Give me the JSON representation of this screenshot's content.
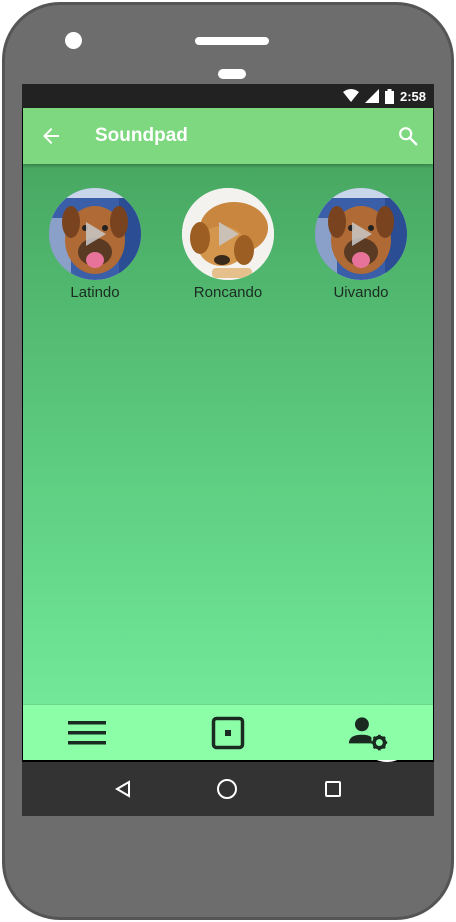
{
  "status": {
    "time": "2:58"
  },
  "appbar": {
    "title": "Soundpad"
  },
  "pads": [
    {
      "label": "Latindo"
    },
    {
      "label": "Roncando"
    },
    {
      "label": "Uivando"
    }
  ],
  "colors": {
    "appbar": "#7dd87f",
    "bottombar": "#8cfea8",
    "background_top": "#48a862",
    "background_bottom": "#72e898"
  },
  "icons": {
    "back": "arrow-left-icon",
    "search": "search-icon",
    "fab": "plus-icon",
    "menu": "menu-icon",
    "center": "square-dot-icon",
    "profile": "user-settings-icon"
  }
}
